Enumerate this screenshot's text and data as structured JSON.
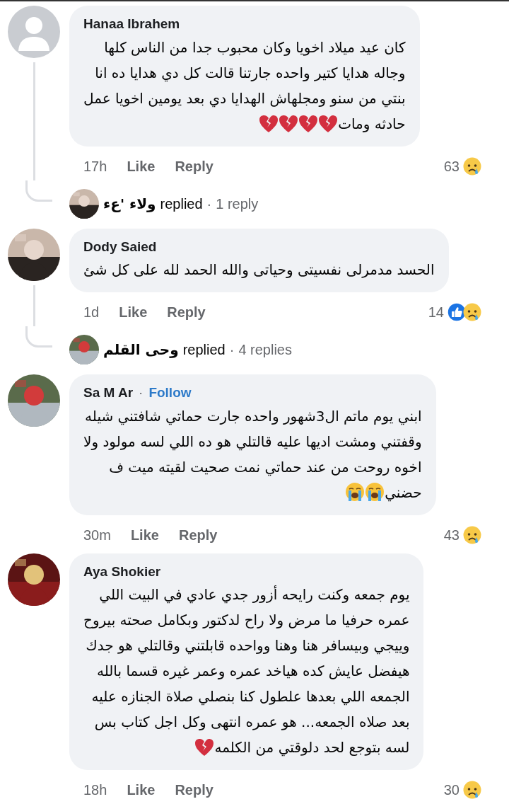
{
  "comments": [
    {
      "author": "Hanaa Ibrahem",
      "avatar": {
        "kind": "placeholder"
      },
      "lines": [
        "كان عيد ميلاد اخويا وكان محبوب جدا من الناس كلها",
        "وجاله هدايا كتير واحده جارتنا قالت كل دي هدايا ده انا",
        "بنتي من سنو ومجلهاش الهدايا دي بعد يومين اخويا عمل",
        "حادثه ومات"
      ],
      "trailing_emoji": [
        {
          "kind": "broken-heart"
        },
        {
          "kind": "broken-heart"
        },
        {
          "kind": "broken-heart"
        },
        {
          "kind": "broken-heart"
        }
      ],
      "time": "17h",
      "like": "Like",
      "reply": "Reply",
      "reaction_count": "63",
      "reactions": [
        {
          "kind": "sad"
        }
      ],
      "replies": {
        "author": "ولاء 'عء",
        "verb": "replied",
        "separator": "·",
        "count": "1 reply"
      }
    },
    {
      "author": "Dody Saied",
      "avatar": {
        "kind": "picture"
      },
      "lines": [
        "الحسد مدمرلى نفسيتى وحياتى والله الحمد لله على كل شئ"
      ],
      "time": "1d",
      "like": "Like",
      "reply": "Reply",
      "reaction_count": "14",
      "reactions": [
        {
          "kind": "like"
        },
        {
          "kind": "sad"
        }
      ],
      "replies": {
        "author": "وحى القلم",
        "verb": "replied",
        "separator": "·",
        "count": "4 replies"
      }
    },
    {
      "author": "Sa M Ar",
      "separator": "·",
      "follow": "Follow",
      "avatar": {
        "kind": "picture"
      },
      "lines": [
        "ابني يوم ماتم ال3شهور واحده  جارت حماتي شافتني شيله",
        "وقفتني ومشت اديها عليه قالتلي هو ده اللي لسه مولود ولا",
        "اخوه روحت من عند حماتي نمت صحيت لقيته ميت ف",
        "حضني"
      ],
      "trailing_emoji": [
        {
          "kind": "crying"
        },
        {
          "kind": "crying"
        }
      ],
      "time": "30m",
      "like": "Like",
      "reply": "Reply",
      "reaction_count": "43",
      "reactions": [
        {
          "kind": "sad"
        }
      ]
    },
    {
      "author": "Aya Shokier",
      "avatar": {
        "kind": "picture"
      },
      "lines": [
        "يوم جمعه وكنت رايحه أزور جدي عادي  في البيت اللي",
        "عمره حرفيا ما مرض ولا راح لدكتور وبكامل صحته بيروح",
        "وييجي وبيسافر هنا وهنا وواحده قابلتني وقالتلي هو جدك",
        "هيفضل عايش كده هياخد عمره وعمر غيره قسما بالله",
        "الجمعه اللي بعدها علطول كنا بنصلي صلاة الجنازه عليه",
        "بعد صلاه الجمعه... هو عمره انتهى وكل اجل كتاب بس",
        "لسه بتوجع لحد دلوقتي من الكلمه"
      ],
      "trailing_emoji": [
        {
          "kind": "broken-heart"
        }
      ],
      "time": "18h",
      "like": "Like",
      "reply": "Reply",
      "reaction_count": "30",
      "reactions": [
        {
          "kind": "sad"
        }
      ]
    }
  ]
}
